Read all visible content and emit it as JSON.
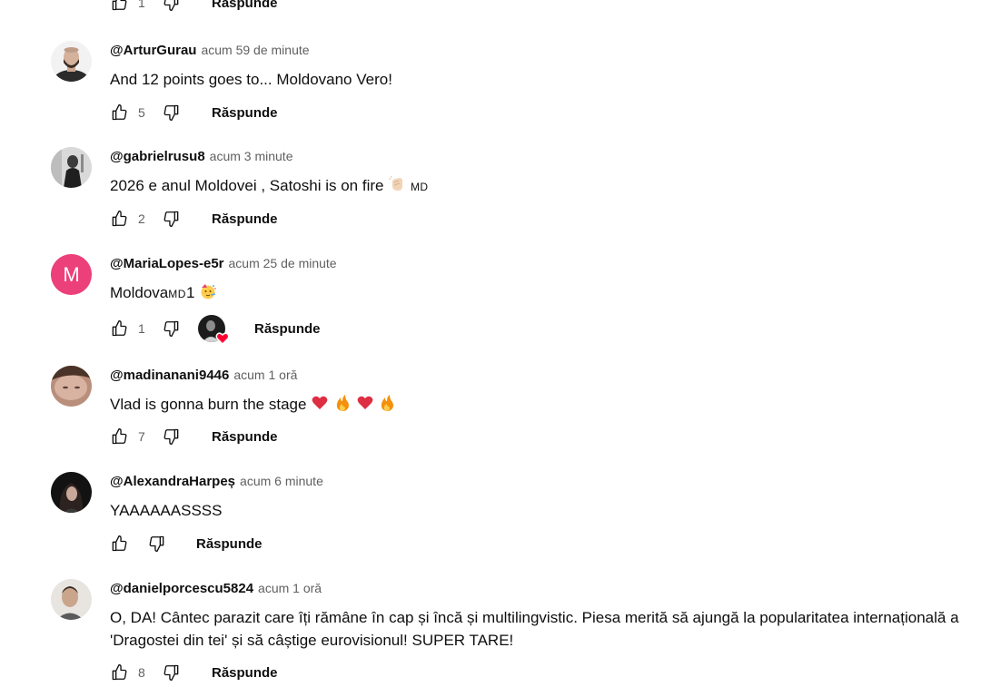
{
  "top_partial": {
    "count": "1",
    "reply_label": "Răspunde"
  },
  "reply_label": "Răspunde",
  "comments": [
    {
      "author": "@ArturGurau",
      "time": "acum 59 de minute",
      "text": "And 12 points goes to... Moldovano Vero!",
      "likes": "5",
      "avatar": "photo-bald-man-dark"
    },
    {
      "author": "@gabrielrusu8",
      "time": "acum 3 minute",
      "text": "2026 e anul Moldovei , Satoshi is on fire",
      "text_suffix": "MD",
      "likes": "2",
      "avatar": "photo-gray-figure"
    },
    {
      "author": "@MariaLopes-e5r",
      "time": "acum 25 de minute",
      "text_prefix": "Moldova",
      "text_md": "MD",
      "text_after": "1",
      "likes": "1",
      "avatar": "letter",
      "avatar_letter": "M",
      "avatar_color": "#ec407a",
      "creator_heart": true
    },
    {
      "author": "@madinanani9446",
      "time": "acum 1 oră",
      "text": "Vlad is gonna  burn the stage",
      "likes": "7",
      "avatar": "photo-face-closeup"
    },
    {
      "author": "@AlexandraHarpeș",
      "time": "acum 6 minute",
      "text": "YAAAAAASSSS",
      "likes": "",
      "avatar": "photo-dark-hair"
    },
    {
      "author": "@danielporcescu5824",
      "time": "acum 1 oră",
      "text": "O, DA! Cântec parazit care îți rămâne în cap și încă și multilingvistic. Piesa merită să ajungă la popularitatea internațională a 'Dragostei din tei' și să câștige eurovisionul! SUPER TARE!",
      "likes": "8",
      "avatar": "photo-face-light"
    }
  ],
  "colors": {
    "text": "#0f0f0f",
    "secondary": "#606060",
    "heart": "#ff0033",
    "letter_avatar": "#ec407a"
  }
}
